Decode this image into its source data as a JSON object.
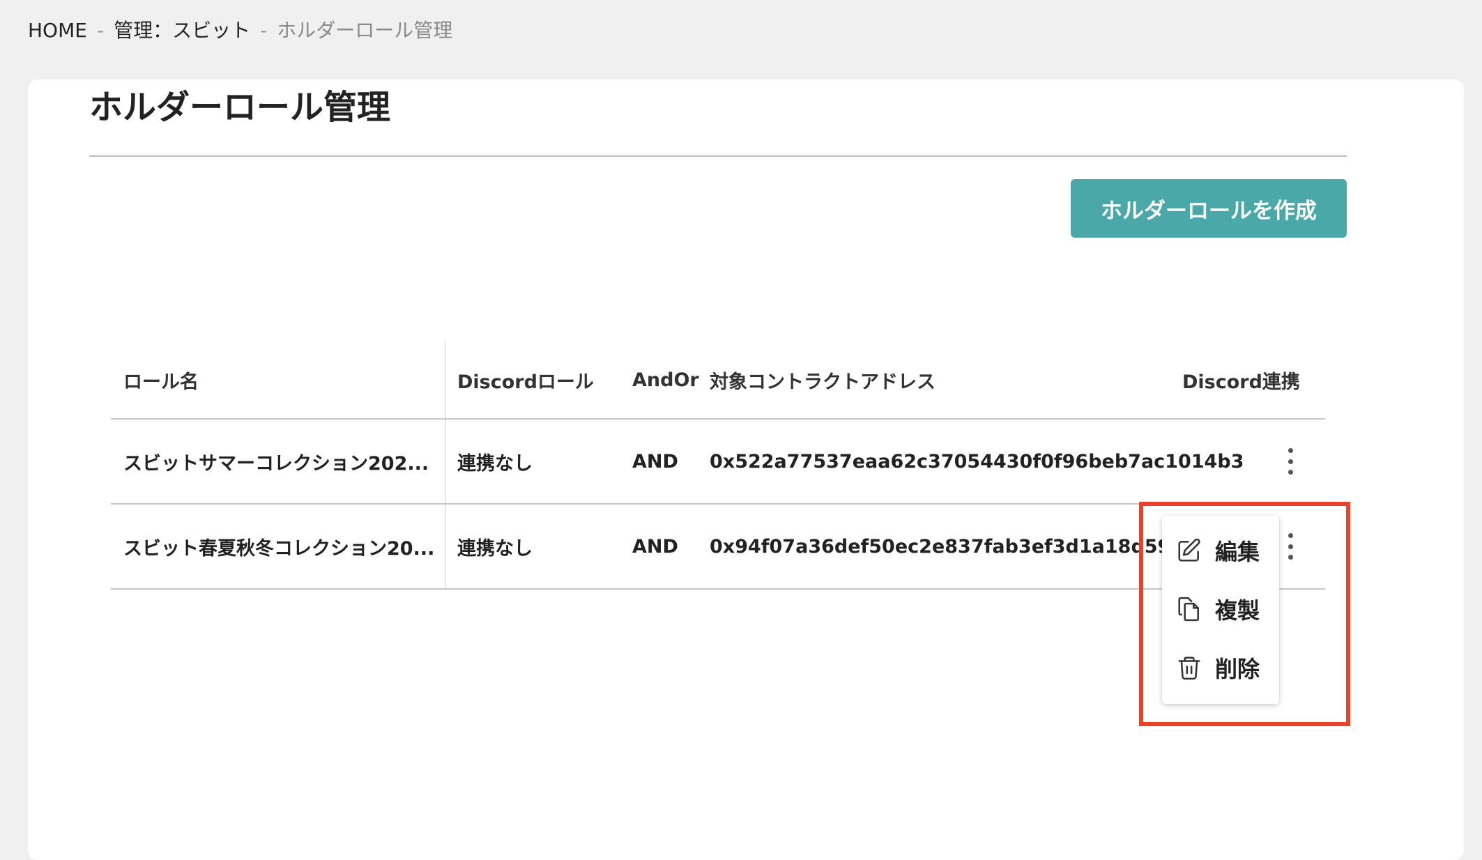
{
  "breadcrumb": {
    "home": "HOME",
    "separator": "-",
    "section": "管理：スビット",
    "current": "ホルダーロール管理"
  },
  "page": {
    "title": "ホルダーロール管理",
    "create_button": "ホルダーロールを作成"
  },
  "table": {
    "headers": {
      "name": "ロール名",
      "discord_role": "Discordロール",
      "and_or": "AndOr",
      "address": "対象コントラクトアドレス",
      "discord_link": "Discord連携"
    },
    "rows": [
      {
        "name": "スビットサマーコレクション202...",
        "discord_role": "連携なし",
        "and_or": "AND",
        "address": "0x522a77537eaa62c37054430f0f96beb7ac1014b3"
      },
      {
        "name": "スビット春夏秋冬コレクション20...",
        "discord_role": "連携なし",
        "and_or": "AND",
        "address": "0x94f07a36def50ec2e837fab3ef3d1a18d59a1e39"
      }
    ]
  },
  "context_menu": {
    "items": [
      {
        "label": "編集",
        "icon": "edit-icon"
      },
      {
        "label": "複製",
        "icon": "copy-icon"
      },
      {
        "label": "削除",
        "icon": "trash-icon"
      }
    ]
  },
  "colors": {
    "primary_button": "#4aa9a8",
    "highlight_box": "#e8422c",
    "background": "#f0f0f0"
  }
}
